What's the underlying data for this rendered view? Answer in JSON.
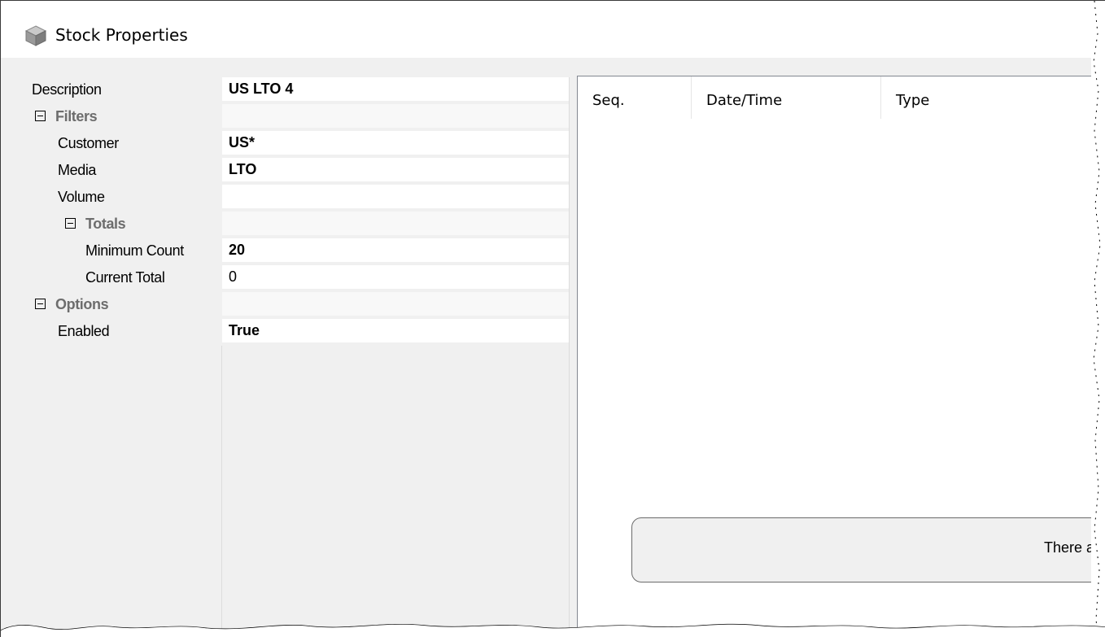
{
  "window": {
    "title": "Stock Properties",
    "icon": "stock-box-icon"
  },
  "property_grid": {
    "rows": [
      {
        "label": "Description",
        "value": "US LTO 4",
        "bold": true,
        "indent": 0,
        "category": false
      },
      {
        "label": "Filters",
        "value": "",
        "bold": false,
        "indent": 0,
        "category": true
      },
      {
        "label": "Customer",
        "value": "US*",
        "bold": true,
        "indent": 1,
        "category": false
      },
      {
        "label": "Media",
        "value": "LTO",
        "bold": true,
        "indent": 1,
        "category": false
      },
      {
        "label": "Volume",
        "value": "",
        "bold": false,
        "indent": 1,
        "category": false
      },
      {
        "label": "Totals",
        "value": "",
        "bold": false,
        "indent": 1,
        "category": true
      },
      {
        "label": "Minimum Count",
        "value": "20",
        "bold": true,
        "indent": 2,
        "category": false
      },
      {
        "label": "Current Total",
        "value": "0",
        "bold": false,
        "indent": 2,
        "category": false
      },
      {
        "label": "Options",
        "value": "",
        "bold": false,
        "indent": 0,
        "category": true
      },
      {
        "label": "Enabled",
        "value": "True",
        "bold": true,
        "indent": 1,
        "category": false
      }
    ]
  },
  "list_view": {
    "columns": [
      "Seq.",
      "Date/Time",
      "Type"
    ],
    "empty_message": "There ar"
  },
  "colors": {
    "panel_bg": "#f0f0f0",
    "category_text": "#6d6d6d",
    "border": "#828790"
  }
}
